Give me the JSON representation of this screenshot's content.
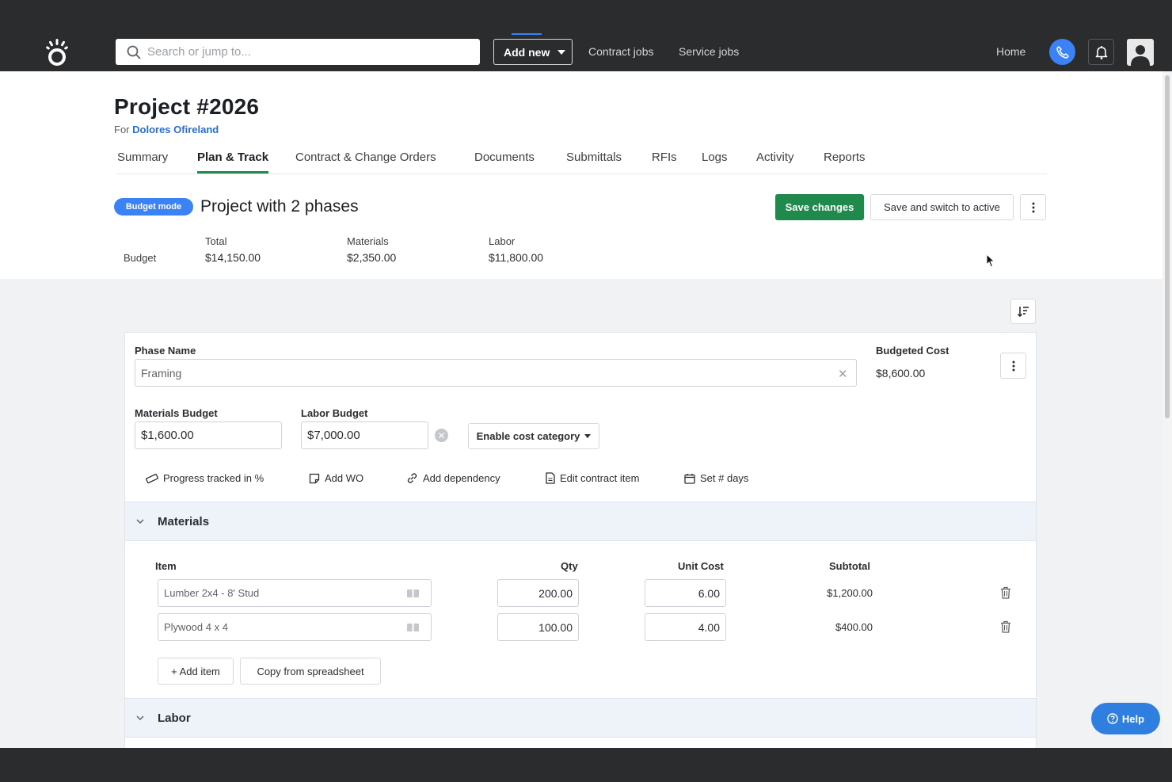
{
  "nav": {
    "search_placeholder": "Search or jump to...",
    "add_new_label": "Add new",
    "contract_jobs": "Contract jobs",
    "service_jobs": "Service jobs",
    "home": "Home"
  },
  "project": {
    "title": "Project #2026",
    "for_prefix": "For",
    "client": "Dolores Ofireland"
  },
  "tabs": [
    {
      "label": "Summary"
    },
    {
      "label": "Plan & Track"
    },
    {
      "label": "Contract & Change Orders"
    },
    {
      "label": "Documents"
    },
    {
      "label": "Submittals"
    },
    {
      "label": "RFIs"
    },
    {
      "label": "Logs"
    },
    {
      "label": "Activity"
    },
    {
      "label": "Reports"
    }
  ],
  "plan": {
    "mode_badge": "Budget mode",
    "title": "Project with 2 phases",
    "save_changes": "Save changes",
    "save_switch": "Save and switch to active"
  },
  "budget_summary": {
    "row_label": "Budget",
    "total_label": "Total",
    "total_value": "$14,150.00",
    "materials_label": "Materials",
    "materials_value": "$2,350.00",
    "labor_label": "Labor",
    "labor_value": "$11,800.00"
  },
  "phase": {
    "name_label": "Phase Name",
    "name_value": "Framing",
    "budgeted_cost_label": "Budgeted Cost",
    "budgeted_cost_value": "$8,600.00",
    "materials_budget_label": "Materials Budget",
    "materials_budget_value": "$1,600.00",
    "labor_budget_label": "Labor Budget",
    "labor_budget_value": "$7,000.00",
    "enable_cost_category": "Enable cost category",
    "actions": {
      "progress": "Progress tracked in %",
      "add_wo": "Add WO",
      "add_dependency": "Add dependency",
      "edit_contract_item": "Edit contract item",
      "set_days": "Set # days"
    }
  },
  "materials": {
    "section_title": "Materials",
    "col_item": "Item",
    "col_qty": "Qty",
    "col_unit_cost": "Unit Cost",
    "col_subtotal": "Subtotal",
    "rows": [
      {
        "item": "Lumber 2x4 - 8' Stud",
        "qty": "200.00",
        "unit_cost": "6.00",
        "subtotal": "$1,200.00"
      },
      {
        "item": "Plywood 4 x 4",
        "qty": "100.00",
        "unit_cost": "4.00",
        "subtotal": "$400.00"
      }
    ],
    "add_item": "+ Add item",
    "copy_spreadsheet": "Copy from spreadsheet"
  },
  "labor": {
    "section_title": "Labor"
  },
  "help": {
    "label": "Help"
  },
  "colors": {
    "primary_green": "#1f8a4c",
    "accent_blue": "#3b82f6",
    "link_blue": "#2a6ed4",
    "nav_bg": "#2b2c2e"
  }
}
